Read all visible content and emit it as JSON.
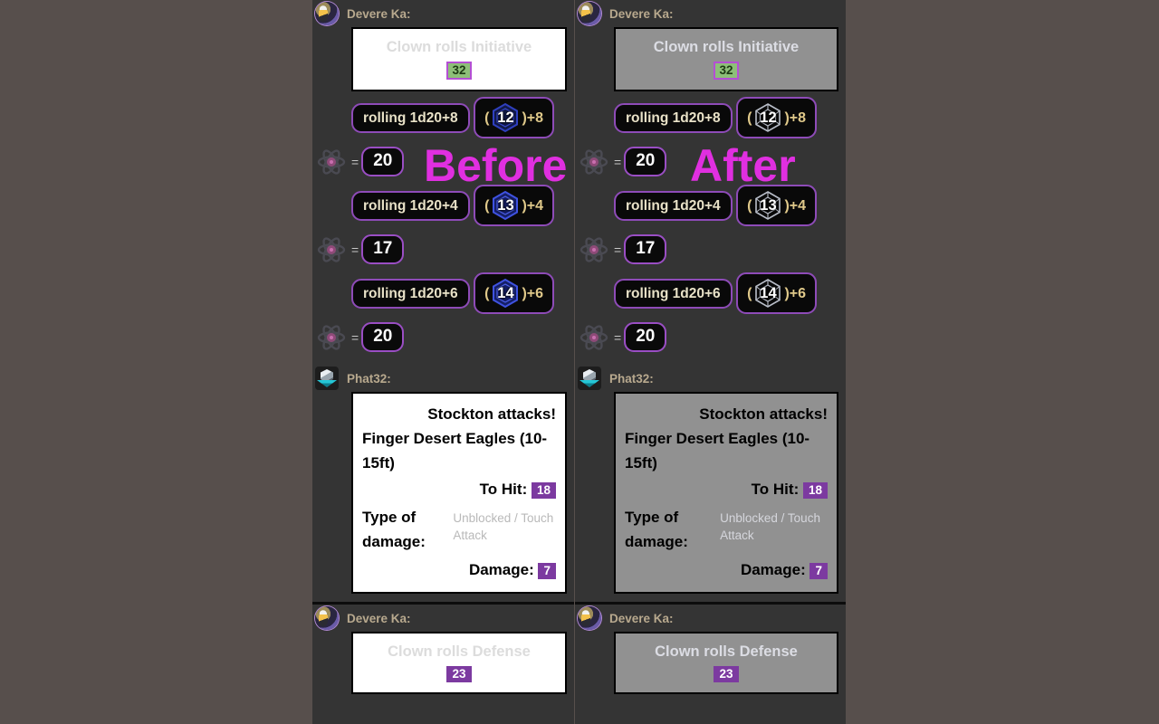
{
  "labels": {
    "before": "Before",
    "after": "After",
    "accent": "#e02fe0"
  },
  "speakers": {
    "devere": "Devere Ka:",
    "phat": "Phat32:"
  },
  "messages": {
    "initiative": {
      "text": "Clown rolls Initiative",
      "value": "32",
      "badge_color": "#8dbf78"
    },
    "defense": {
      "text": "Clown rolls Defense",
      "value": "23",
      "badge_color": "#7c3aa0"
    }
  },
  "attack": {
    "title": "Stockton attacks!",
    "subtitle": "Finger Desert Eagles (10-15ft)",
    "tohit_label": "To Hit:",
    "tohit_value": "18",
    "type_label": "Type of damage:",
    "type_value": "Unblocked / Touch Attack",
    "damage_label": "Damage:",
    "damage_value": "7"
  },
  "rolls": [
    {
      "formula": "rolling 1d20+8",
      "die": "12",
      "modifier": "+8",
      "total": "20",
      "open_paren": "(",
      "close_paren": ")"
    },
    {
      "formula": "rolling 1d20+4",
      "die": "13",
      "modifier": "+4",
      "total": "17",
      "open_paren": "(",
      "close_paren": ")"
    },
    {
      "formula": "rolling 1d20+6",
      "die": "14",
      "modifier": "+6",
      "total": "20",
      "open_paren": "(",
      "close_paren": ")"
    }
  ]
}
